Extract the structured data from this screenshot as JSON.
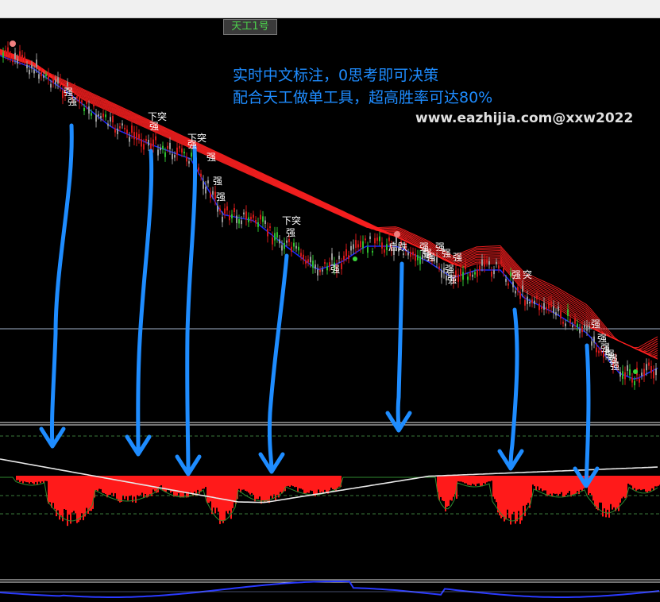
{
  "indicator_badge": "天工1号",
  "annotation": {
    "line1": "实时中文标注，0思考即可决策",
    "line2": "配合天工做单工具，超高胜率可达80%"
  },
  "watermark": "www.eazhijia.com@xxw2022",
  "signal_labels": {
    "strong": "强",
    "break_down": "下突",
    "start_fall": "启跌",
    "break": "突"
  },
  "colors": {
    "background": "#000000",
    "ribbon": "#ff2020",
    "ribbon_core": "#1a2aff",
    "arrow": "#1e8cff",
    "histogram": "#ff1a1a",
    "signal_line": "#e8e8e8",
    "bull_candle": "#2fbf2f",
    "bear_candle": "#d01818",
    "doji_candle": "#9a9a9a"
  }
}
